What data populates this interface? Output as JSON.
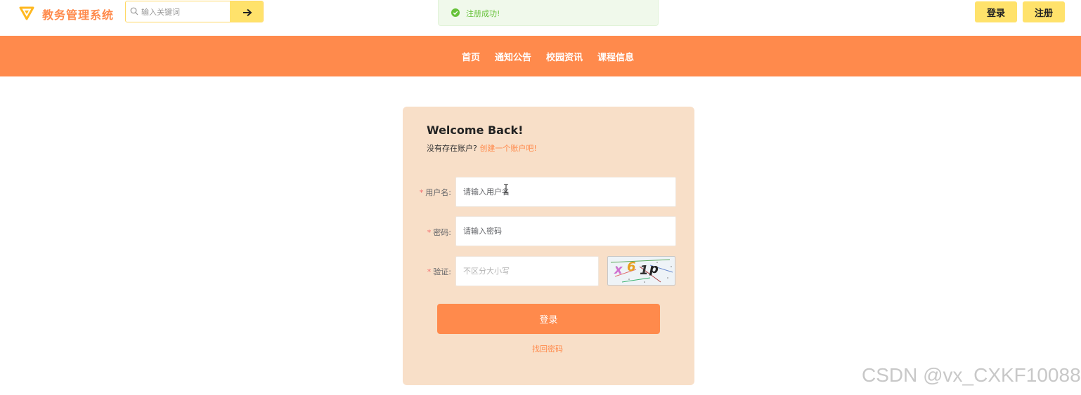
{
  "header": {
    "app_title": "教务管理系统",
    "search": {
      "placeholder": "输入关键词",
      "value": ""
    },
    "buttons": {
      "login": "登录",
      "register": "注册"
    }
  },
  "toast": {
    "message": "注册成功!",
    "color": "#67c23a"
  },
  "nav": {
    "items": [
      "首页",
      "通知公告",
      "校园资讯",
      "课程信息"
    ]
  },
  "login_card": {
    "title": "Welcome Back!",
    "no_account_text": "没有存在账户?",
    "create_account_link": "创建一个账户吧!",
    "fields": {
      "username": {
        "label": "用户名:",
        "placeholder": "请输入用户名",
        "value": ""
      },
      "password": {
        "label": "密码:",
        "placeholder": "请输入密码",
        "value": ""
      },
      "captcha": {
        "label": "验证:",
        "placeholder": "不区分大小写",
        "value": "",
        "image_text": "x61p"
      }
    },
    "login_button": "登录",
    "forgot_link": "找回密码"
  },
  "watermark": "CSDN @vx_CXKF10088",
  "colors": {
    "accent": "#ff8a4c",
    "yellow": "#ffe26b",
    "card_bg": "#f8dfc8",
    "required": "#f56c6c"
  }
}
